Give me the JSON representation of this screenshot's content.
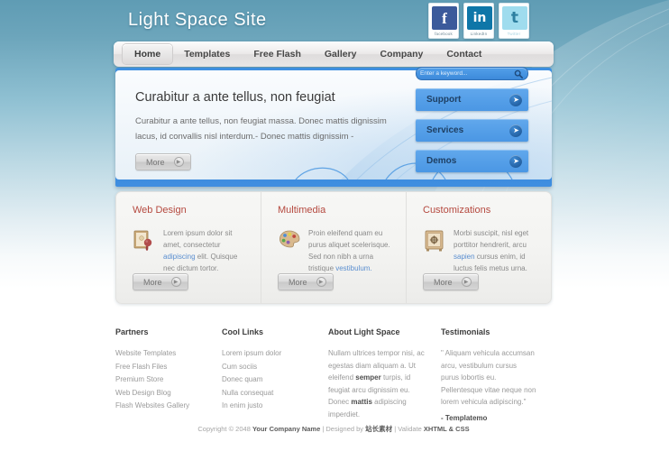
{
  "site": {
    "title": "Light Space Site"
  },
  "social": [
    {
      "name": "facebook",
      "label": "facebook",
      "glyph": "f"
    },
    {
      "name": "linkedin",
      "label": "LinkedIn",
      "glyph": "in"
    },
    {
      "name": "twitter",
      "label": "Twitter",
      "glyph": "t"
    }
  ],
  "nav": [
    {
      "label": "Home",
      "active": true
    },
    {
      "label": "Templates",
      "active": false
    },
    {
      "label": "Free Flash",
      "active": false
    },
    {
      "label": "Gallery",
      "active": false
    },
    {
      "label": "Company",
      "active": false
    },
    {
      "label": "Contact",
      "active": false
    }
  ],
  "hero": {
    "heading": "Curabitur a ante tellus, non feugiat",
    "body": "Curabitur a ante tellus, non feugiat massa. Donec mattis dignissim lacus, id convallis nisl interdum.- Donec mattis dignissim -",
    "more_label": "More"
  },
  "search": {
    "placeholder": "Enter a keyword...",
    "value": "",
    "icon": "search-icon"
  },
  "side_buttons": [
    {
      "label": "Support"
    },
    {
      "label": "Services"
    },
    {
      "label": "Demos"
    }
  ],
  "features": [
    {
      "title": "Web Design",
      "icon": "book-seal-icon",
      "text_before": "Lorem ipsum dolor sit amet, consectetur ",
      "link": "adipiscing",
      "text_after": " elit. Quisque nec dictum tortor.",
      "more_label": "More"
    },
    {
      "title": "Multimedia",
      "icon": "paint-palette-icon",
      "text_before": "Proin eleifend quam eu purus aliquet scelerisque. Sed non nibh a urna tristique ",
      "link": "vestibulum.",
      "text_after": "",
      "more_label": "More"
    },
    {
      "title": "Customizations",
      "icon": "safe-vault-icon",
      "text_before": "Morbi suscipit, nisl eget porttitor hendrerit, arcu ",
      "link": "sapien",
      "text_after": " cursus enim, id luctus felis metus urna.",
      "more_label": "More"
    }
  ],
  "footer": {
    "partners": {
      "title": "Partners",
      "links": [
        "Website Templates",
        "Free Flash Files",
        "Premium Store",
        "Web Design Blog",
        "Flash Websites Gallery"
      ]
    },
    "cool_links": {
      "title": "Cool Links",
      "links": [
        "Lorem ipsum dolor",
        "Cum sociis",
        "Donec quam",
        "Nulla consequat",
        "In enim justo"
      ]
    },
    "about": {
      "title": "About Light Space",
      "part1": "Nullam ultrices tempor nisi, ac egestas diam aliquam a. Ut eleifend ",
      "bold1": "semper",
      "part2": " turpis, id feugiat arcu dignissim eu. Donec ",
      "bold2": "mattis",
      "part3": " adipiscing imperdiet."
    },
    "testimonials": {
      "title": "Testimonials",
      "quote": "\" Aliquam vehicula accumsan arcu, vestibulum cursus purus lobortis eu. Pellentesque vitae neque non lorem vehicula adipiscing.\"",
      "author": "- Templatemo"
    }
  },
  "copyright": {
    "prefix": "Copyright © 2048 ",
    "company": "Your Company Name",
    "sep1": " | Designed by ",
    "designer": "站长素材",
    "sep2": " | Validate ",
    "validate": "XHTML & CSS"
  },
  "colors": {
    "bg_top": "#5f9cb4",
    "accent_blue": "#3e8fe0",
    "side_btn": "#559fe8",
    "feature_title": "#b5493f",
    "link": "#5b8fd0"
  }
}
